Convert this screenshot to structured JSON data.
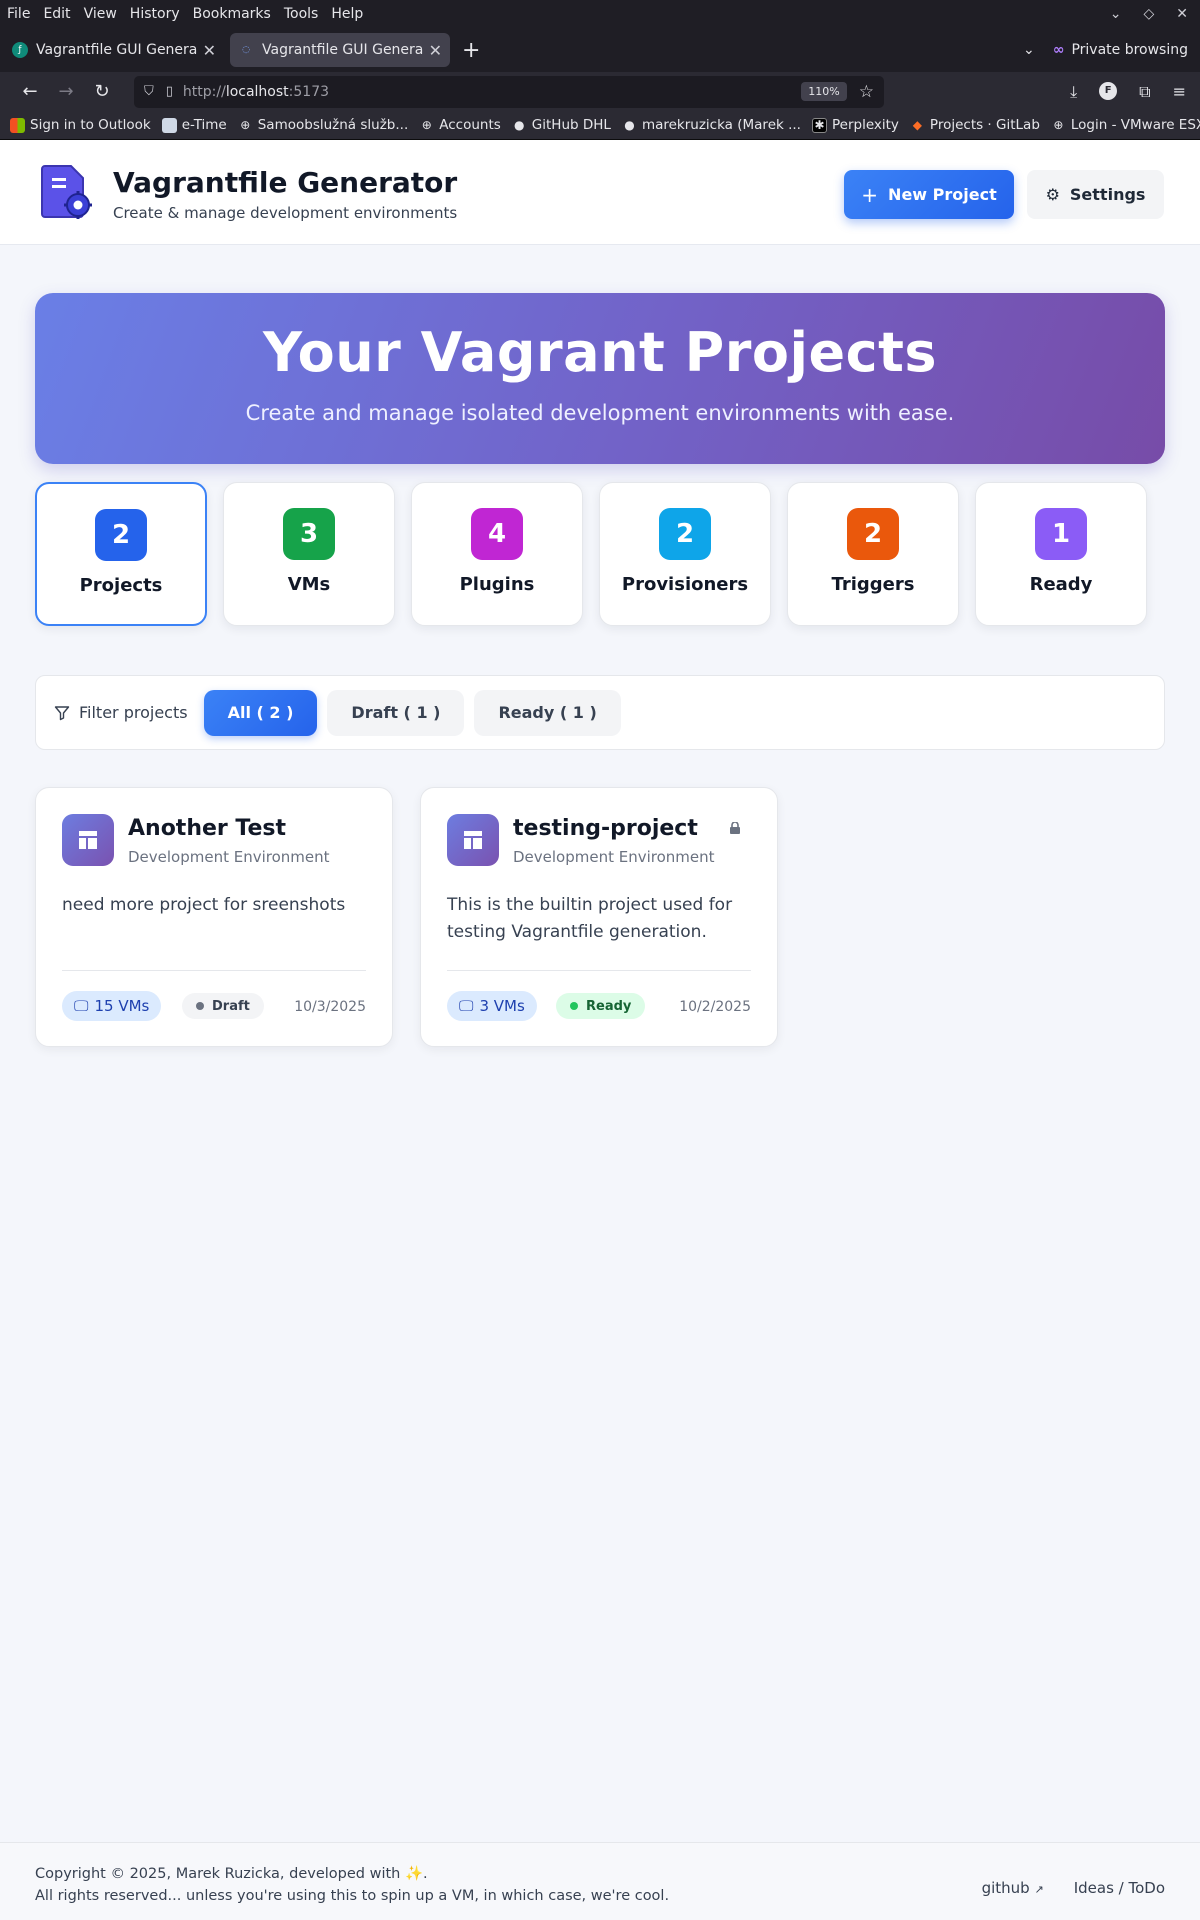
{
  "browser": {
    "menu": [
      "File",
      "Edit",
      "View",
      "History",
      "Bookmarks",
      "Tools",
      "Help"
    ],
    "tabs": [
      {
        "title": "Vagrantfile GUI Generator",
        "active": false
      },
      {
        "title": "Vagrantfile GUI Generator",
        "active": true
      }
    ],
    "private_label": "Private browsing",
    "url_prefix": "http://",
    "url_host": "localhost",
    "url_port": ":5173",
    "zoom": "110%",
    "bookmarks": [
      "Sign in to Outlook",
      "e-Time",
      "Samoobslužná služb...",
      "Accounts",
      "GitHub DHL",
      "marekruzicka (Marek ...",
      "Perplexity",
      "Projects · GitLab",
      "Login - VMware ESXi"
    ]
  },
  "header": {
    "title": "Vagrantfile Generator",
    "subtitle": "Create & manage development environments",
    "new_project_label": "New Project",
    "settings_label": "Settings"
  },
  "hero": {
    "title": "Your Vagrant Projects",
    "subtitle": "Create and manage isolated development environments with ease."
  },
  "stats": [
    {
      "value": "2",
      "label": "Projects",
      "color": "#2563eb"
    },
    {
      "value": "3",
      "label": "VMs",
      "color": "#16a34a"
    },
    {
      "value": "4",
      "label": "Plugins",
      "color": "#c026d3"
    },
    {
      "value": "2",
      "label": "Provisioners",
      "color": "#0ea5e9"
    },
    {
      "value": "2",
      "label": "Triggers",
      "color": "#ea580c"
    },
    {
      "value": "1",
      "label": "Ready",
      "color": "#8b5cf6"
    }
  ],
  "filter": {
    "label": "Filter projects",
    "chips": [
      {
        "label": "All ( 2 )",
        "active": true
      },
      {
        "label": "Draft ( 1 )",
        "active": false
      },
      {
        "label": "Ready ( 1 )",
        "active": false
      }
    ]
  },
  "projects": [
    {
      "name": "Another Test",
      "type": "Development Environment",
      "description": "need more project for sreenshots",
      "vms": "15 VMs",
      "status": "Draft",
      "date": "10/3/2025",
      "locked": false
    },
    {
      "name": "testing-project",
      "type": "Development Environment",
      "description": "This is the builtin project used for testing Vagrantfile generation.",
      "vms": "3 VMs",
      "status": "Ready",
      "date": "10/2/2025",
      "locked": true
    }
  ],
  "footer": {
    "copyright_line1": "Copyright © 2025, Marek Ruzicka, developed with ✨.",
    "copyright_line2": "All rights reserved... unless you're using this to spin up a VM, in which case, we're cool.",
    "github_label": "github",
    "ideas_label": "Ideas / ToDo"
  }
}
